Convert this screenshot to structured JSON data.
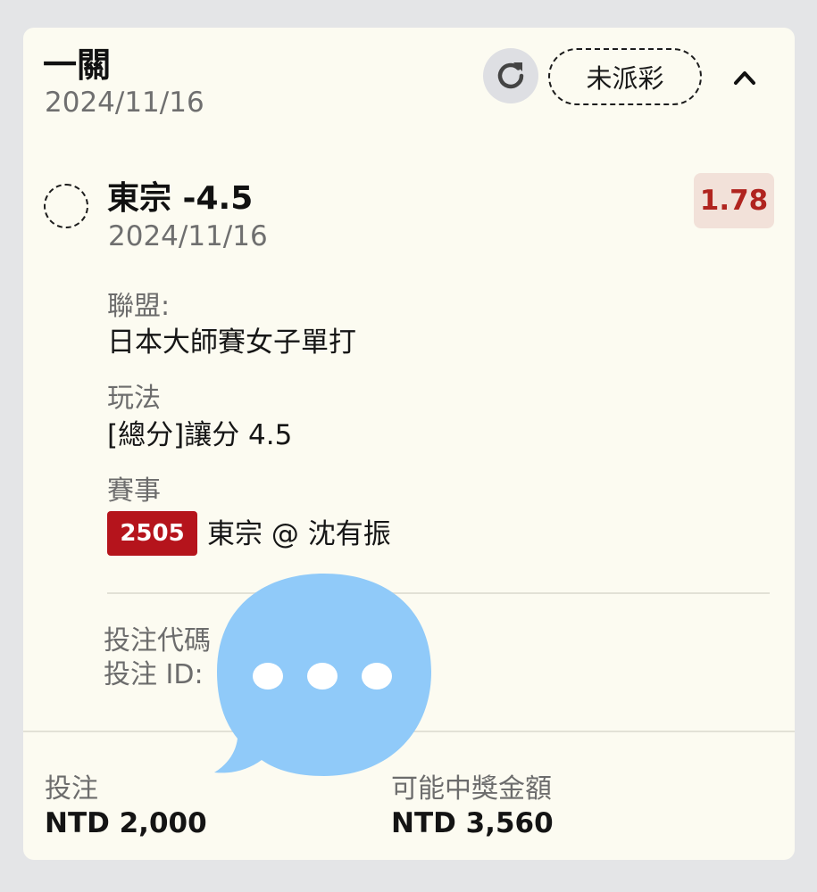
{
  "header": {
    "title": "一關",
    "date": "2024/11/16",
    "status": "未派彩"
  },
  "selection": {
    "title": "東宗 -4.5",
    "date": "2024/11/16",
    "odds": "1.78",
    "league_label": "聯盟:",
    "league_value": "日本大師賽女子單打",
    "market_label": "玩法",
    "market_value": "[總分]讓分 4.5",
    "event_label": "賽事",
    "event_code": "2505",
    "event_value": "東宗 @ 沈有振"
  },
  "bet_info": {
    "code_label": "投注代碼",
    "id_label": "投注 ID:"
  },
  "footer": {
    "stake_label": "投注",
    "stake_value": "NTD 2,000",
    "payout_label": "可能中獎金額",
    "payout_value": "NTD 3,560"
  },
  "icons": {
    "refresh": "refresh-icon",
    "collapse": "chevron-up-icon",
    "overlay": "chat-bubble-icon"
  },
  "colors": {
    "card_bg": "#fcfbf1",
    "odds_text": "#b0241f",
    "odds_bg": "#f2e1d9",
    "event_code_bg": "#b5141c",
    "bubble": "#90caf9"
  }
}
